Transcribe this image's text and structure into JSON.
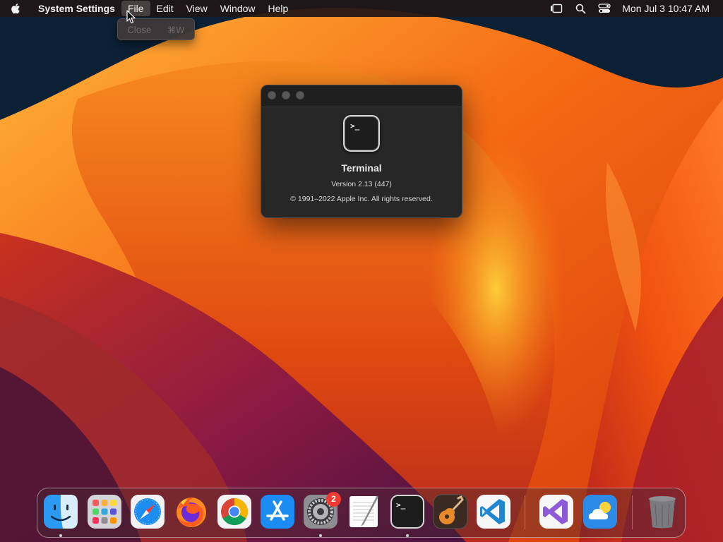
{
  "menubar": {
    "app_name": "System Settings",
    "menus": [
      {
        "label": "File",
        "open": true
      },
      {
        "label": "Edit"
      },
      {
        "label": "View"
      },
      {
        "label": "Window"
      },
      {
        "label": "Help"
      }
    ],
    "clock": "Mon Jul 3  10:47 AM",
    "status_icons": [
      "stage-manager-icon",
      "search-icon",
      "control-center-icon"
    ]
  },
  "file_menu": {
    "items": [
      {
        "label": "Close",
        "shortcut": "⌘W",
        "enabled": false
      }
    ]
  },
  "about_window": {
    "app_name": "Terminal",
    "version": "Version 2.13 (447)",
    "copyright": "© 1991–2022 Apple Inc. All rights reserved.",
    "icon_prompt": ">_"
  },
  "dock": {
    "apps": [
      {
        "name": "finder",
        "running": true
      },
      {
        "name": "launchpad",
        "running": false
      },
      {
        "name": "safari",
        "running": false
      },
      {
        "name": "firefox",
        "running": false
      },
      {
        "name": "chrome",
        "running": false
      },
      {
        "name": "app-store",
        "running": false
      },
      {
        "name": "system-settings",
        "running": true,
        "badge": "2"
      },
      {
        "name": "textedit",
        "running": false
      },
      {
        "name": "terminal",
        "running": true
      },
      {
        "name": "garageband",
        "running": false
      },
      {
        "name": "vscode",
        "running": false
      },
      {
        "name": "visual-studio",
        "running": false
      },
      {
        "name": "weather",
        "running": false
      },
      {
        "name": "trash",
        "running": false
      }
    ]
  },
  "colors": {
    "menubar_bg": "#201616",
    "badge": "#ef3b31",
    "wallpaper_orange": "#f25a0f",
    "wallpaper_magenta": "#8a1745"
  }
}
